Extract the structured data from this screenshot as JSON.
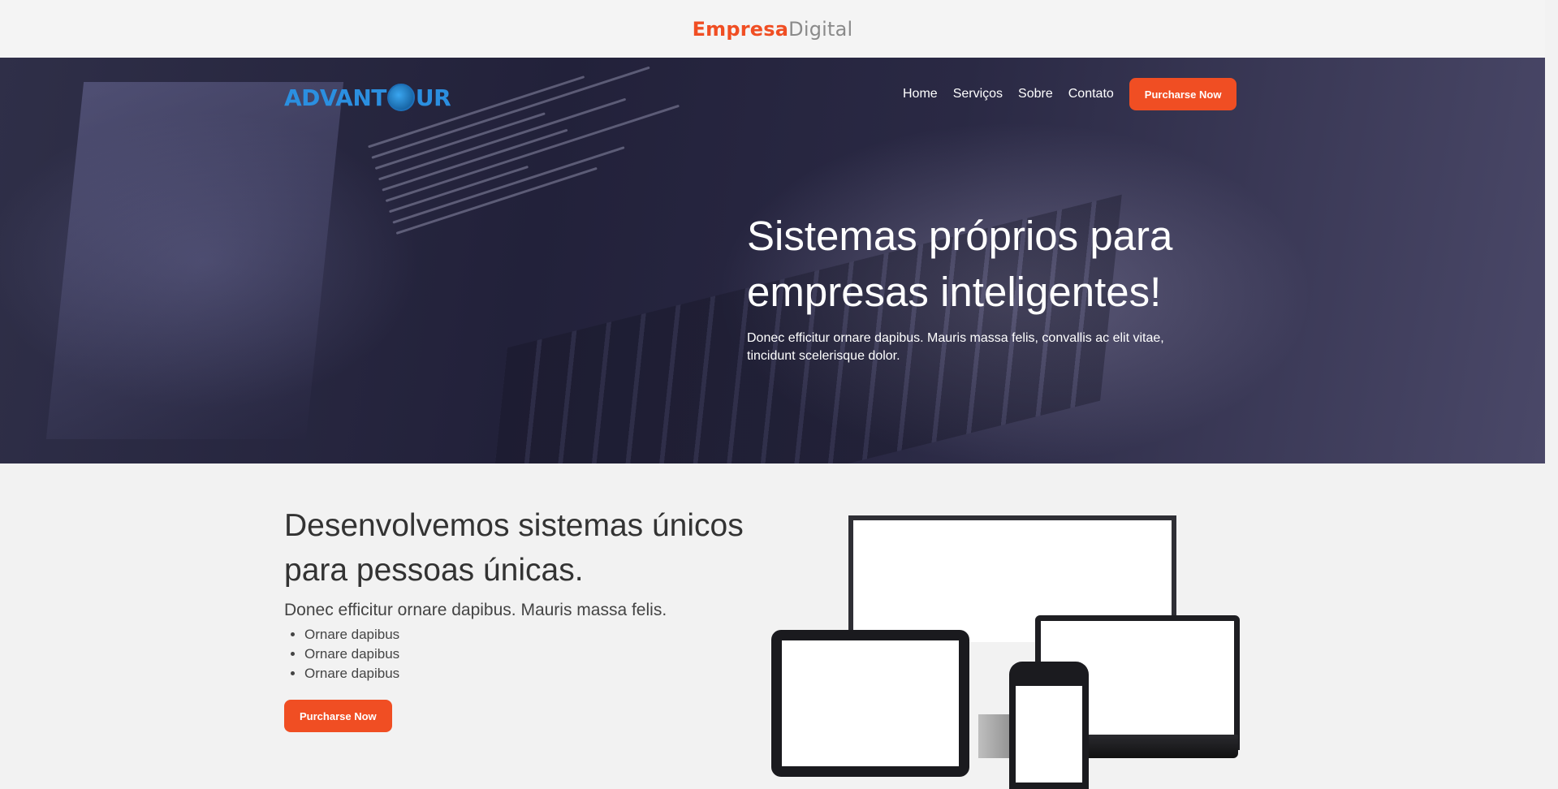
{
  "topbar": {
    "brand_bold": "Empresa",
    "brand_light": "Digital"
  },
  "header": {
    "logo_left": "ADVANT",
    "logo_right": "UR",
    "logo_icon": "globe-icon",
    "nav": [
      "Home",
      "Serviços",
      "Sobre",
      "Contato"
    ],
    "cta_label": "Purcharse Now"
  },
  "hero": {
    "title_line1": "Sistemas próprios para",
    "title_line2": "empresas inteligentes!",
    "subtitle": "Donec efficitur ornare dapibus. Mauris massa felis, convallis ac elit vitae, tincidunt scelerisque dolor."
  },
  "features": {
    "title_line1": "Desenvolvemos sistemas únicos",
    "title_line2": "para pessoas únicas.",
    "subtitle": "Donec efficitur ornare dapibus. Mauris massa felis.",
    "items": [
      "Ornare dapibus",
      "Ornare dapibus",
      "Ornare dapibus"
    ],
    "cta_label": "Purcharse Now"
  },
  "colors": {
    "accent": "#f04e23",
    "hero_bg": "#2a2944",
    "logo": "#2b8fe0"
  }
}
